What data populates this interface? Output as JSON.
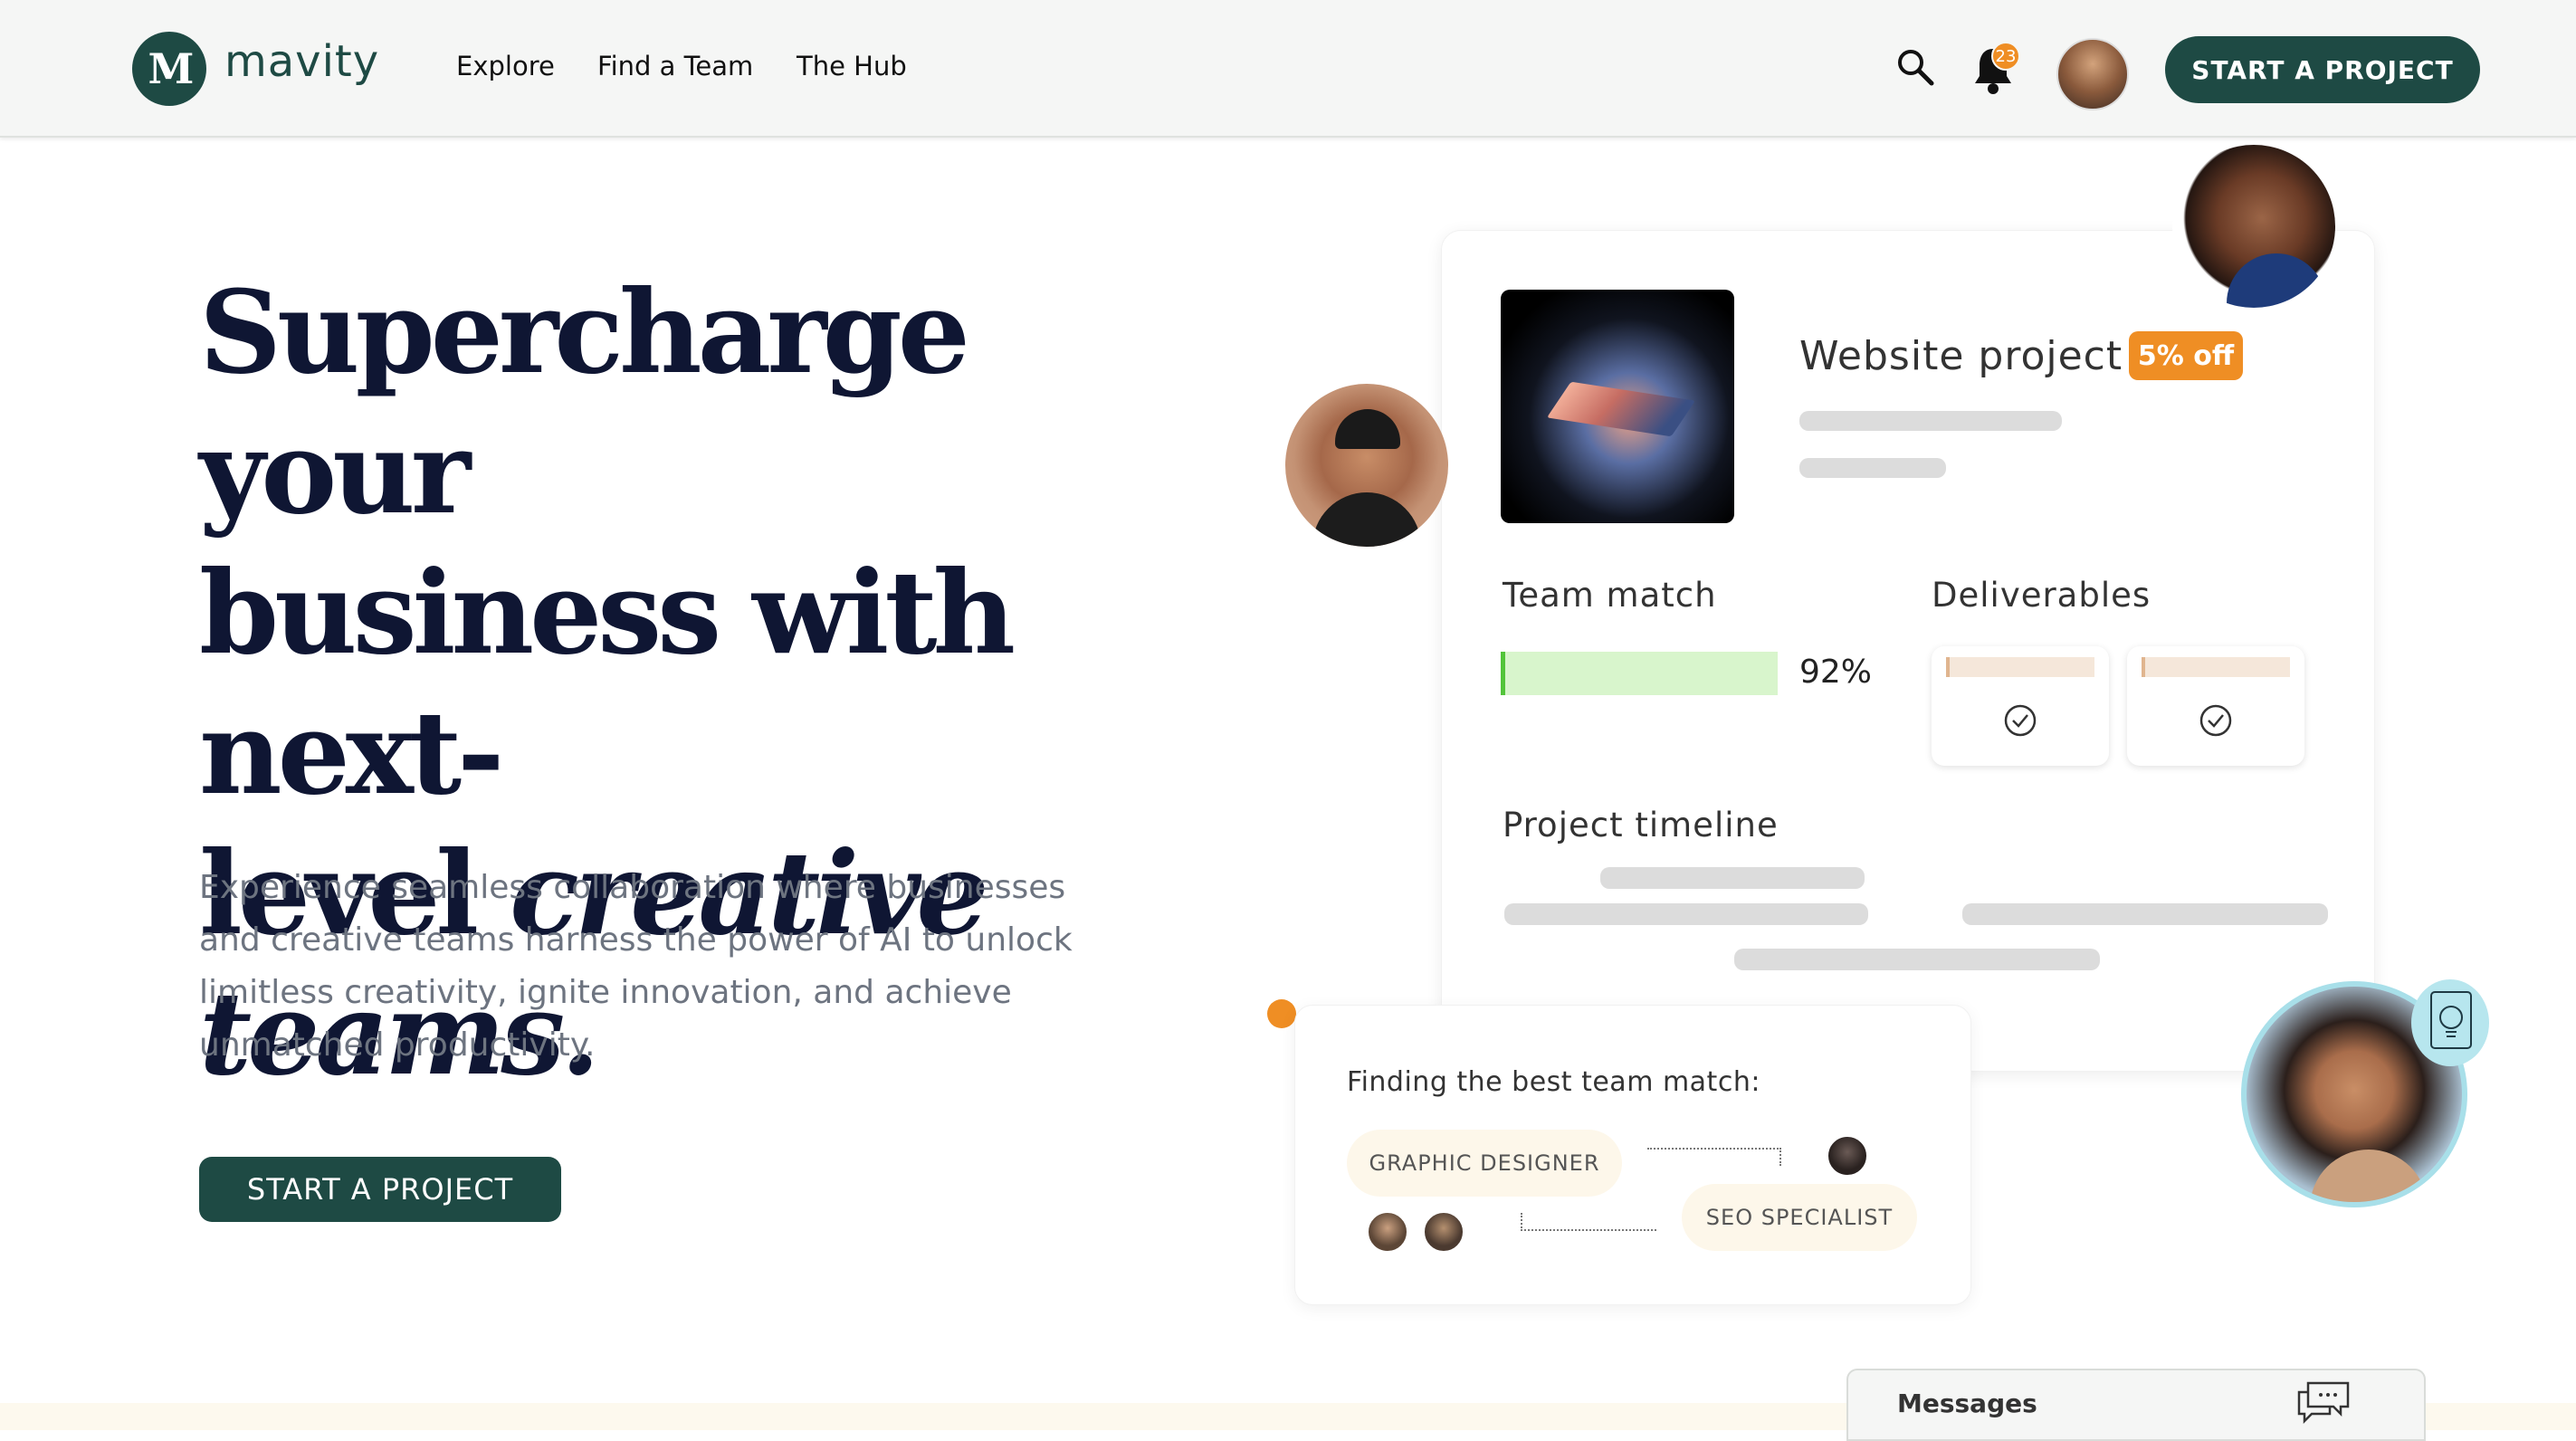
{
  "header": {
    "logo_text": "mavity",
    "logo_mark": "M",
    "nav": [
      "Explore",
      "Find a Team",
      "The Hub"
    ],
    "notification_count": "23",
    "cta_label": "START A PROJECT"
  },
  "hero": {
    "title_line1": "Supercharge your",
    "title_line2_regular": "business with ",
    "title_line2_bold": "next-",
    "title_line3_bold": "level ",
    "title_line3_italic": "creative",
    "title_line4_italic": "teams.",
    "subtitle": "Experience seamless collaboration where businesses and creative teams harness the power of AI to unlock limitless creativity, ignite innovation, and achieve unmatched productivity.",
    "cta_label": "START A PROJECT"
  },
  "project_card": {
    "title": "Website project",
    "discount": "5% off",
    "team_match_label": "Team match",
    "team_match_value": "92%",
    "team_match_fraction": 0.92,
    "deliverables_label": "Deliverables",
    "timeline_label": "Project timeline"
  },
  "match_panel": {
    "heading": "Finding the best team match:",
    "roles": [
      "GRAPHIC DESIGNER",
      "SEO SPECIALIST"
    ]
  },
  "messages": {
    "label": "Messages"
  },
  "colors": {
    "brand": "#1e4a44",
    "accent": "#ef8e24",
    "match_fill": "#d8f5cc",
    "avatar_ring": "#a8dfe9"
  },
  "icons": [
    "search-icon",
    "bell-icon",
    "check-circle-icon",
    "lightbulb-icon",
    "chat-icon"
  ]
}
